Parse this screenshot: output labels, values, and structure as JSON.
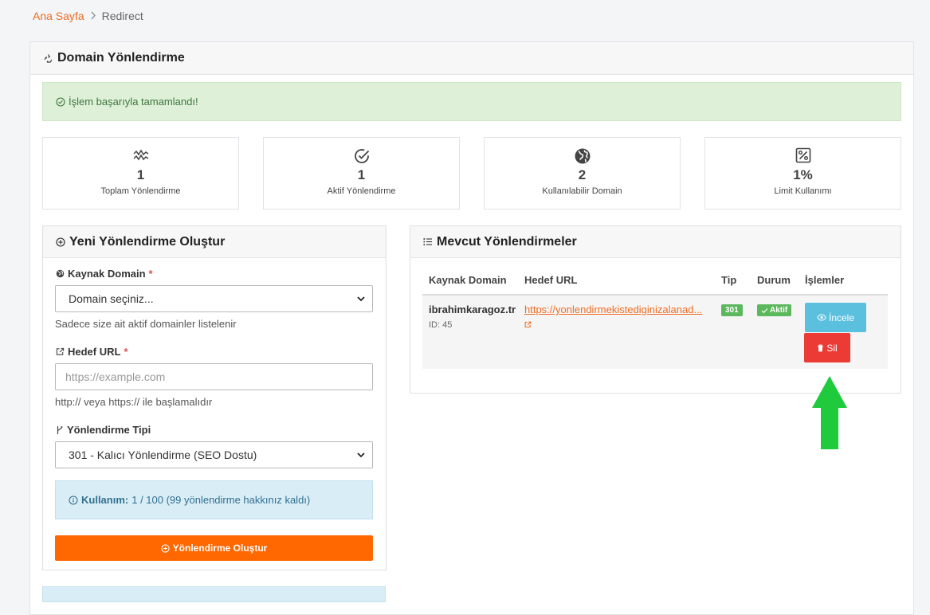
{
  "breadcrumb": {
    "home": "Ana Sayfa",
    "current": "Redirect"
  },
  "card": {
    "title": "Domain Yönlendirme"
  },
  "alert": {
    "success": "İşlem başarıyla tamamlandı!"
  },
  "stats": [
    {
      "icon": "activity-icon",
      "value": "1",
      "label": "Toplam Yönlendirme"
    },
    {
      "icon": "check-circle-icon",
      "value": "1",
      "label": "Aktif Yönlendirme"
    },
    {
      "icon": "globe-icon",
      "value": "2",
      "label": "Kullanılabilir Domain"
    },
    {
      "icon": "percent-icon",
      "value": "1%",
      "label": "Limit Kullanımı"
    }
  ],
  "form": {
    "title": "Yeni Yönlendirme Oluştur",
    "source_label": "Kaynak Domain",
    "required_mark": "*",
    "source_selected": "Domain seçiniz...",
    "source_help": "Sadece size ait aktif domainler listelenir",
    "target_label": "Hedef URL",
    "target_value": "",
    "target_placeholder": "https://example.com",
    "target_help": "http:// veya https:// ile başlamalıdır",
    "type_label": "Yönlendirme Tipi",
    "type_selected": "301 - Kalıcı Yönlendirme (SEO Dostu)",
    "usage_label": "Kullanım:",
    "usage_text": "1 / 100 (99 yönlendirme hakkınız kaldı)",
    "submit_label": "Yönlendirme Oluştur"
  },
  "list": {
    "title": "Mevcut Yönlendirmeler",
    "columns": [
      "Kaynak Domain",
      "Hedef URL",
      "Tip",
      "Durum",
      "İşlemler"
    ],
    "rows": [
      {
        "domain": "ibrahimkaragoz.tr",
        "id": "ID: 45",
        "url": "https://yonlendirmekistediginizalanad...",
        "type": "301",
        "status": "Aktif",
        "view_label": "İncele",
        "delete_label": "Sil"
      }
    ]
  },
  "colors": {
    "accent": "#ff6700",
    "link": "#ef6c22",
    "success": "#5cb85c",
    "info": "#5bc0de",
    "danger": "#ec3a34",
    "annotation_arrow": "#1fcb3d"
  }
}
